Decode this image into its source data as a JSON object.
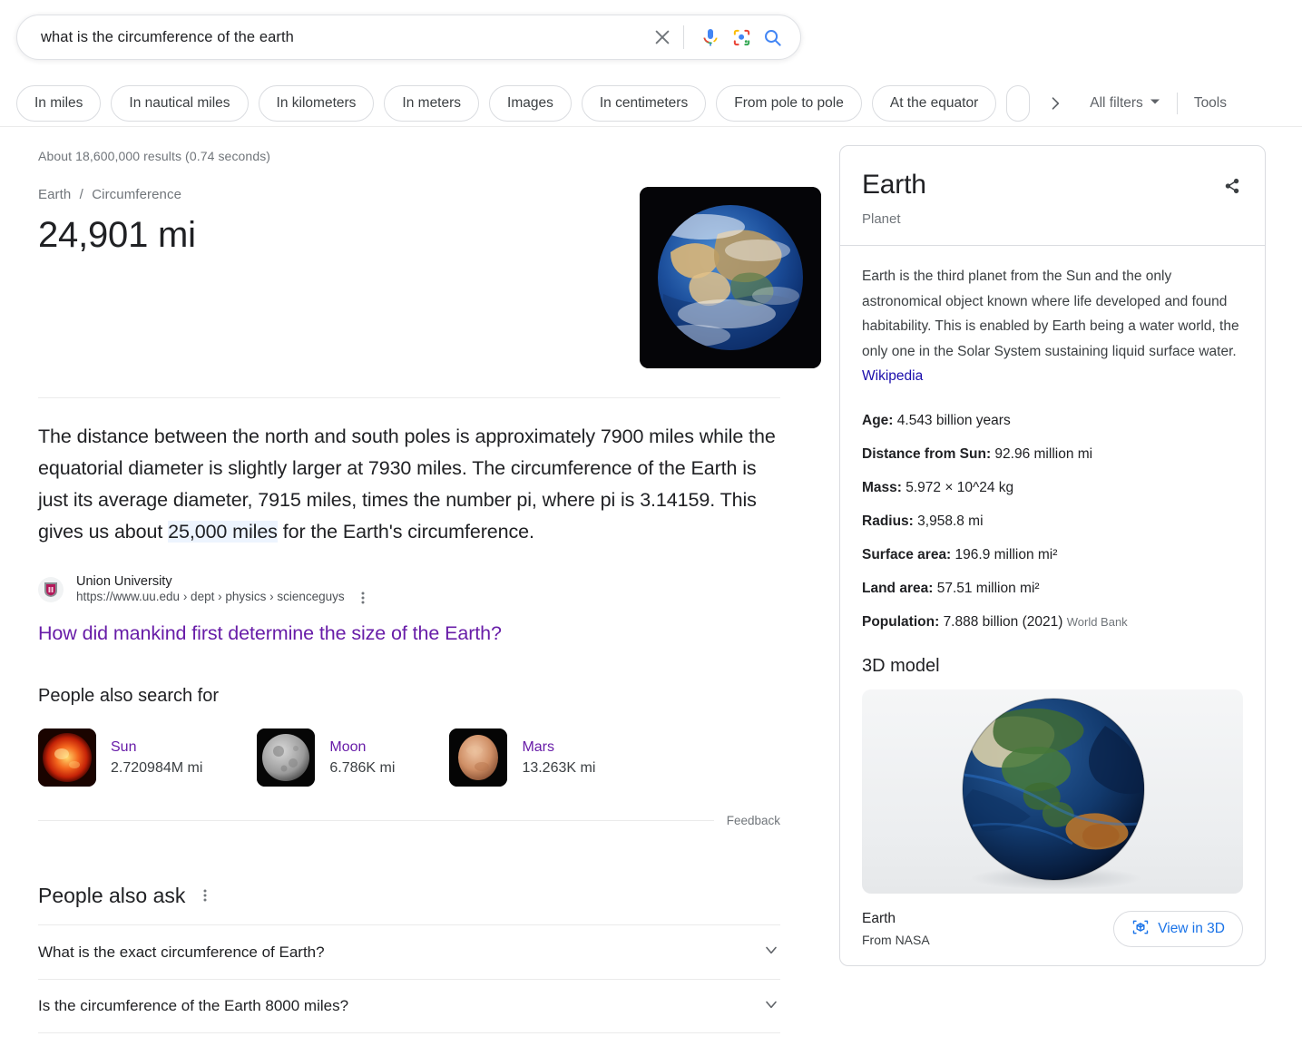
{
  "search": {
    "query": "what is the circumference of the earth",
    "placeholder": "Search",
    "clear_icon": "close-icon",
    "voice_icon": "microphone-icon",
    "lens_icon": "google-lens-icon",
    "submit_icon": "search-icon"
  },
  "filters": {
    "chips": [
      "In miles",
      "In nautical miles",
      "In kilometers",
      "In meters",
      "Images",
      "In centimeters",
      "From pole to pole",
      "At the equator"
    ],
    "next_icon": "chevron-right-icon",
    "all_filters_label": "All filters",
    "all_filters_icon": "chevron-down-icon",
    "tools_label": "Tools"
  },
  "results": {
    "stats": "About 18,600,000 results (0.74 seconds)",
    "answer": {
      "breadcrumb_entity": "Earth",
      "breadcrumb_sep": "/",
      "breadcrumb_property": "Circumference",
      "value": "24,901 mi",
      "thumb_alt": "earth-photo"
    },
    "snippet": {
      "before": "The distance between the north and south poles is approximately 7900 miles while the equatorial diameter is slightly larger at 7930 miles. The circumference of the Earth is just its average diameter, 7915 miles, times the number pi, where pi is 3.14159. This gives us about ",
      "highlight": "25,000 miles",
      "after": " for the Earth's circumference."
    },
    "source": {
      "favicon": "union-university-shield-icon",
      "site_name": "Union University",
      "url": "https://www.uu.edu › dept › physics › scienceguys",
      "menu_icon": "kebab-menu-icon",
      "title": "How did mankind first determine the size of the Earth?"
    },
    "people_also_search_for": {
      "heading": "People also search for",
      "items": [
        {
          "name": "Sun",
          "value": "2.720984M mi",
          "thumb": "sun-photo"
        },
        {
          "name": "Moon",
          "value": "6.786K mi",
          "thumb": "moon-photo"
        },
        {
          "name": "Mars",
          "value": "13.263K mi",
          "thumb": "mars-photo"
        }
      ],
      "feedback_label": "Feedback"
    },
    "people_also_ask": {
      "heading": "People also ask",
      "menu_icon": "kebab-menu-icon",
      "questions": [
        "What is the exact circumference of Earth?",
        "Is the circumference of the Earth 8000 miles?"
      ],
      "expand_icon": "chevron-down-icon"
    }
  },
  "knowledge_panel": {
    "title": "Earth",
    "subtitle": "Planet",
    "share_icon": "share-icon",
    "description": "Earth is the third planet from the Sun and the only astronomical object known where life developed and found habitability. This is enabled by Earth being a water world, the only one in the Solar System sustaining liquid surface water. ",
    "description_link": "Wikipedia",
    "facts": [
      {
        "label": "Age:",
        "value": "4.543 billion years",
        "source": ""
      },
      {
        "label": "Distance from Sun:",
        "value": "92.96 million mi",
        "source": ""
      },
      {
        "label": "Mass:",
        "value": "5.972 × 10^24 kg",
        "source": ""
      },
      {
        "label": "Radius:",
        "value": "3,958.8 mi",
        "source": ""
      },
      {
        "label": "Surface area:",
        "value": "196.9 million mi²",
        "source": ""
      },
      {
        "label": "Land area:",
        "value": "57.51 million mi²",
        "source": ""
      },
      {
        "label": "Population:",
        "value": "7.888 billion (2021)",
        "source": "World Bank"
      }
    ],
    "model3d": {
      "heading": "3D model",
      "image_alt": "earth-3d-globe",
      "label": "Earth",
      "from_prefix": "From ",
      "from_source": "NASA",
      "view_button_label": "View in 3D",
      "view_button_icon": "cube-3d-icon"
    }
  },
  "colors": {
    "link_blue": "#1a73e8",
    "visited_purple": "#681da8",
    "text_primary": "#202124",
    "text_secondary": "#70757a",
    "highlight": "#d2e3fc",
    "border": "#dadce0"
  }
}
